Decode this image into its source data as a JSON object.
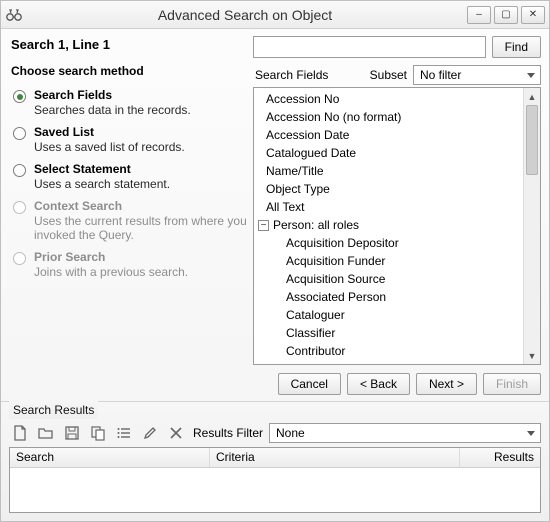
{
  "window": {
    "title": "Advanced Search on Object",
    "appIcon": "binoculars-icon",
    "minimize": "–",
    "maximize": "▢",
    "close": "✕"
  },
  "header": {
    "search_line": "Search 1, Line 1"
  },
  "methods": {
    "heading": "Choose search method",
    "items": [
      {
        "title": "Search Fields",
        "desc": "Searches data in the records.",
        "checked": true,
        "enabled": true
      },
      {
        "title": "Saved List",
        "desc": "Uses a saved list of records.",
        "checked": false,
        "enabled": true
      },
      {
        "title": "Select Statement",
        "desc": "Uses a search statement.",
        "checked": false,
        "enabled": true
      },
      {
        "title": "Context Search",
        "desc": "Uses the current results from where you invoked the Query.",
        "checked": false,
        "enabled": false
      },
      {
        "title": "Prior Search",
        "desc": "Joins with a previous search.",
        "checked": false,
        "enabled": false
      }
    ]
  },
  "search": {
    "input_value": "",
    "find_label": "Find",
    "fields_label": "Search Fields",
    "subset_label": "Subset",
    "subset_value": "No filter"
  },
  "fields": {
    "top": [
      "Accession No",
      "Accession No (no format)",
      "Accession Date",
      "Catalogued Date",
      "Name/Title",
      "Object Type",
      "All Text"
    ],
    "group_label": "Person: all roles",
    "children": [
      "Acquisition Depositor",
      "Acquisition Funder",
      "Acquisition Source",
      "Associated Person",
      "Cataloguer",
      "Classifier",
      "Contributor"
    ]
  },
  "wizard": {
    "cancel": "Cancel",
    "back": "< Back",
    "next": "Next >",
    "finish": "Finish"
  },
  "results": {
    "heading": "Search Results",
    "filter_label": "Results Filter",
    "filter_value": "None",
    "columns": {
      "c1": "Search",
      "c2": "Criteria",
      "c3": "Results"
    },
    "toolbar_icons": [
      "new-file-icon",
      "open-folder-icon",
      "save-icon",
      "copy-icon",
      "list-icon",
      "edit-icon",
      "delete-icon"
    ]
  }
}
